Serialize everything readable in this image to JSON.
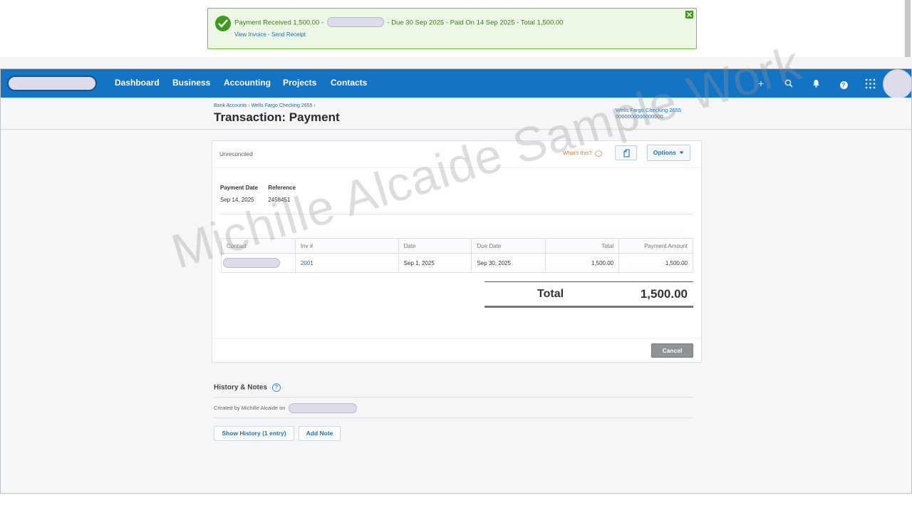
{
  "notification": {
    "message_start": "Payment Received 1,500.00 -",
    "message_end": "- Due 30 Sep 2025 - Paid On 14 Sep 2025 - Total 1,500.00",
    "view_invoice": "View Invoice",
    "link_sep": "-",
    "send_receipt": "Send Receipt"
  },
  "nav": {
    "items": [
      "Dashboard",
      "Business",
      "Accounting",
      "Projects",
      "Contacts"
    ],
    "icons": [
      "plus-icon",
      "search-icon",
      "bell-icon",
      "help-icon",
      "apps-grid-icon"
    ],
    "plus_glyph": "+",
    "help_glyph": "?"
  },
  "breadcrumb": {
    "item1": "Bank Accounts",
    "item2": "Wells Fargo Checking 2655",
    "sep": "›"
  },
  "page_title": "Transaction: Payment",
  "account": {
    "name": "Wells Fargo Checking 2655",
    "number": "0000000000000000"
  },
  "card": {
    "status": "Unreconciled",
    "whats_this": "What's this?",
    "options": "Options",
    "payment_date_label": "Payment Date",
    "reference_label": "Reference",
    "payment_date": "Sep 14, 2025",
    "reference": "2458451",
    "table": {
      "headers": [
        "Contact",
        "Inv #",
        "Date",
        "Due Date",
        "Total",
        "Payment Amount"
      ],
      "rows": [
        {
          "inv": "2001",
          "date": "Sep 1, 2025",
          "due": "Sep 30, 2025",
          "total": "1,500.00",
          "amount": "1,500.00"
        }
      ]
    },
    "total_label": "Total",
    "total_value": "1,500.00",
    "cancel": "Cancel"
  },
  "history": {
    "title": "History & Notes",
    "help_glyph": "?",
    "created_by": "Created by Michille Alcaide on",
    "show_history": "Show History (1 entry)",
    "add_note": "Add Note"
  },
  "watermark": "Michille Alcaide Sample Work",
  "colors": {
    "nav_blue": "#1374c4",
    "success_green": "#3f9b1f",
    "link_blue": "#1f6fb5",
    "cancel_gray": "#8f9396"
  }
}
